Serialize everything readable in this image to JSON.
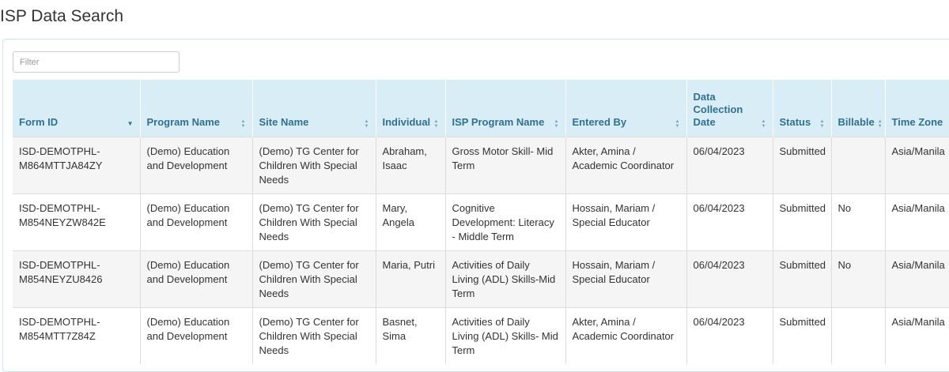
{
  "page": {
    "title": "ISP Data Search"
  },
  "filter": {
    "placeholder": "Filter",
    "value": ""
  },
  "table": {
    "columns": [
      {
        "label": "Form ID",
        "sort": "desc"
      },
      {
        "label": "Program Name",
        "sort": "both"
      },
      {
        "label": "Site Name",
        "sort": "both"
      },
      {
        "label": "Individual",
        "sort": "both"
      },
      {
        "label": "ISP Program Name",
        "sort": "both"
      },
      {
        "label": "Entered By",
        "sort": "both"
      },
      {
        "label": "Data Collection Date",
        "sort": "both"
      },
      {
        "label": "Status",
        "sort": "both"
      },
      {
        "label": "Billable",
        "sort": "both"
      },
      {
        "label": "Time Zone",
        "sort": "none"
      }
    ],
    "rows": [
      {
        "form_id": "ISD-DEMOTPHL-M864MTTJA84ZY",
        "program_name": "(Demo) Education and Development",
        "site_name": "(Demo) TG Center for Children With Special Needs",
        "individual": "Abraham, Isaac",
        "isp_program_name": "Gross Motor Skill- Mid Term",
        "entered_by": "Akter, Amina / Academic Coordinator",
        "data_collection_date": "06/04/2023",
        "status": "Submitted",
        "billable": "",
        "time_zone": "Asia/Manila"
      },
      {
        "form_id": "ISD-DEMOTPHL-M854NEYZW842E",
        "program_name": "(Demo) Education and Development",
        "site_name": "(Demo) TG Center for Children With Special Needs",
        "individual": "Mary, Angela",
        "isp_program_name": "Cognitive Development: Literacy - Middle Term",
        "entered_by": "Hossain, Mariam / Special Educator",
        "data_collection_date": "06/04/2023",
        "status": "Submitted",
        "billable": "No",
        "time_zone": "Asia/Manila"
      },
      {
        "form_id": "ISD-DEMOTPHL-M854NEYZU8426",
        "program_name": "(Demo) Education and Development",
        "site_name": "(Demo) TG Center for Children With Special Needs",
        "individual": "Maria, Putri",
        "isp_program_name": "Activities of Daily Living (ADL) Skills-Mid Term",
        "entered_by": "Hossain, Mariam / Special Educator",
        "data_collection_date": "06/04/2023",
        "status": "Submitted",
        "billable": "No",
        "time_zone": "Asia/Manila"
      },
      {
        "form_id": "ISD-DEMOTPHL-M854MTT7Z84Z",
        "program_name": "(Demo) Education and Development",
        "site_name": "(Demo) TG Center for Children With Special Needs",
        "individual": "Basnet, Sima",
        "isp_program_name": "Activities of Daily Living (ADL) Skills- Mid Term",
        "entered_by": "Akter, Amina / Academic Coordinator",
        "data_collection_date": "06/04/2023",
        "status": "Submitted",
        "billable": "",
        "time_zone": "Asia/Manila"
      }
    ]
  },
  "icons": {
    "sort_desc": "sort-desc-icon",
    "sort_both": "sort-both-icon"
  },
  "colors": {
    "header_bg": "#d9edf7",
    "header_text": "#31708f",
    "odd_row_bg": "#f5f5f5"
  }
}
